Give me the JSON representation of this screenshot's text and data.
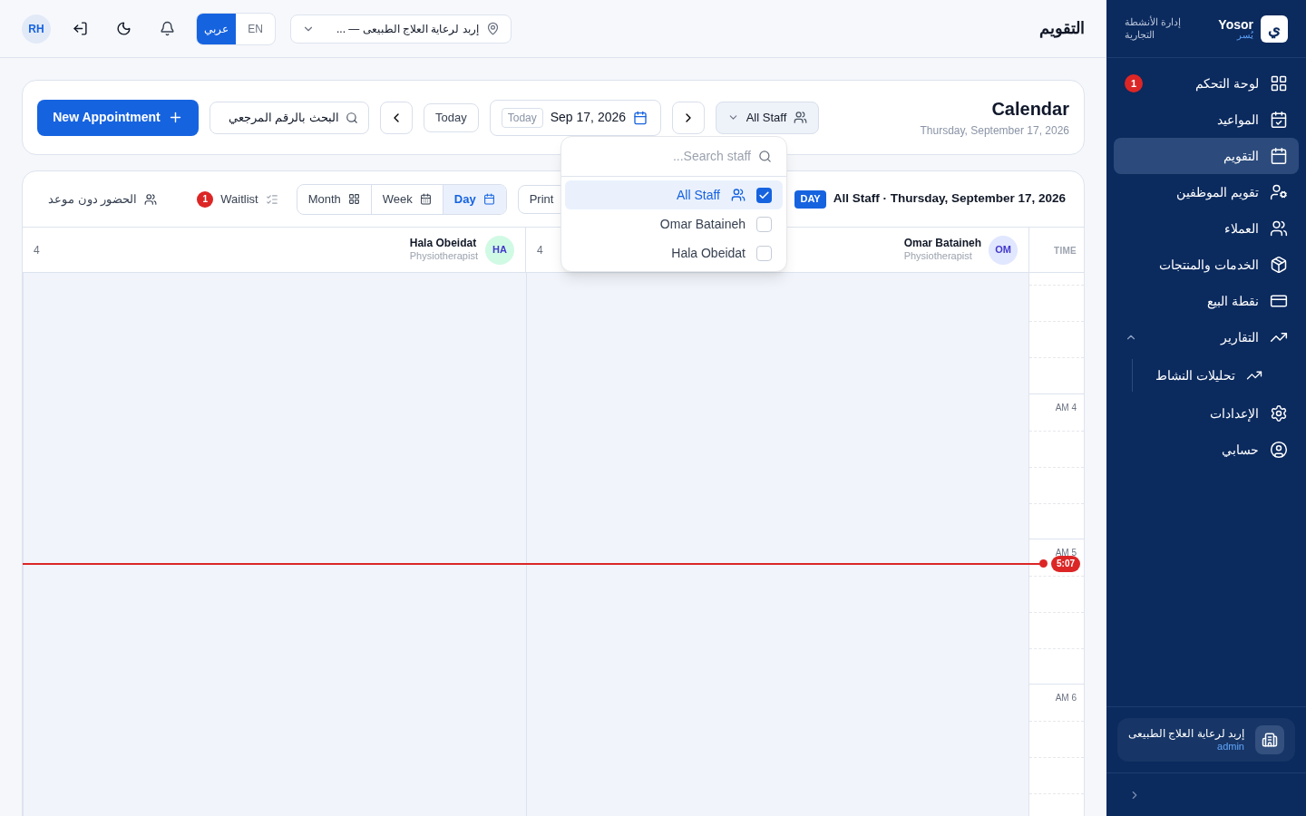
{
  "sidebar": {
    "brand": "Yosor",
    "brand_sub": "يُسر",
    "logo_letter": "ي",
    "tagline": "إدارة الأنشطة التجارية",
    "items": [
      {
        "label": "لوحة التحكم",
        "selected": false,
        "badge": "1"
      },
      {
        "label": "المواعيد",
        "selected": false
      },
      {
        "label": "التقويم",
        "selected": true
      },
      {
        "label": "تقويم الموظفين",
        "selected": false
      },
      {
        "label": "العملاء",
        "selected": false
      },
      {
        "label": "الخدمات والمنتجات",
        "selected": false
      },
      {
        "label": "نقطة البيع",
        "selected": false
      },
      {
        "label": "التقارير",
        "selected": false,
        "expanded": true,
        "children": [
          {
            "label": "تحليلات النشاط",
            "selected": false
          }
        ]
      },
      {
        "label": "الإعدادات",
        "selected": false
      },
      {
        "label": "حسابي",
        "selected": false
      }
    ],
    "org": {
      "name": "إربد لرعاية العلاج الطبيعى",
      "role": "admin"
    }
  },
  "topbar": {
    "title": "التقويم",
    "location": "إربد لرعاية العلاج الطبيعى — ...",
    "languages": [
      {
        "label": "EN",
        "selected": false
      },
      {
        "label": "عربي",
        "selected": true
      }
    ],
    "avatar": "RH"
  },
  "header": {
    "title": "Calendar",
    "date": "Thursday, September 17, 2026",
    "new_button": "New Appointment",
    "search_placeholder": "البحث بالرقم المرجعي",
    "today_button": "Today",
    "date_chip": "Today",
    "date_value": "Sep 17, 2026",
    "staff_filter": "All Staff"
  },
  "toolbar": {
    "walk_in": "الحضور دون موعد",
    "waitlist": "Waitlist",
    "waitlist_count": "1",
    "views": [
      {
        "label": "Day",
        "selected": true
      },
      {
        "label": "Week",
        "selected": false
      },
      {
        "label": "Month",
        "selected": false
      }
    ],
    "print": "Print",
    "today_badge": "DAY",
    "title": "All Staff · Thursday, September 17, 2026"
  },
  "grid": {
    "time_heading": "TIME",
    "staff": [
      {
        "initials": "OM",
        "name": "Omar Bataineh",
        "role": "Physiotherapist",
        "count": "4",
        "color": "#e0e7ff"
      },
      {
        "initials": "HA",
        "name": "Hala Obeidat",
        "role": "Physiotherapist",
        "count": "4",
        "color": "#d1fae5"
      }
    ],
    "hours": [
      "AM 4",
      "AM 5",
      "AM 6"
    ],
    "now": "5:07"
  },
  "staff_dropdown": {
    "placeholder": "Search staff...",
    "options": [
      {
        "kind": "all",
        "label": "All Staff",
        "checked": true,
        "selected": true
      },
      {
        "kind": "person",
        "label": "Omar Bataineh",
        "checked": false,
        "selected": false
      },
      {
        "kind": "person",
        "label": "Hala Obeidat",
        "checked": false,
        "selected": false
      }
    ]
  }
}
